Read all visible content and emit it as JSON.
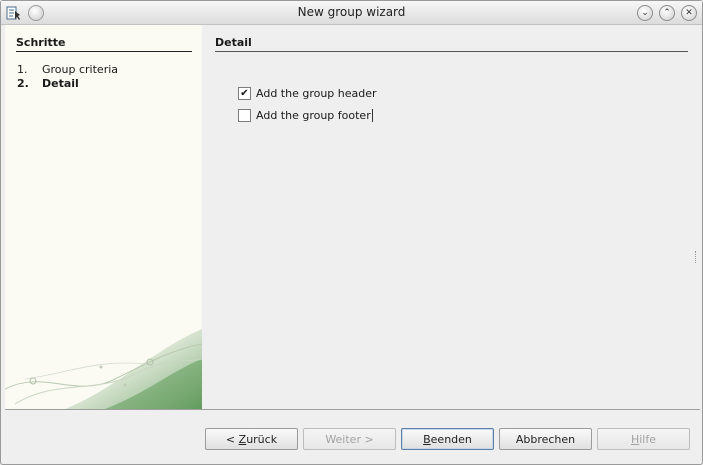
{
  "window": {
    "title": "New group wizard",
    "controls": {
      "minimize_icon": "⌄",
      "maximize_icon": "⌃",
      "close_icon": "✕"
    }
  },
  "steps": {
    "title": "Schritte",
    "items": [
      {
        "num": "1.",
        "label": "Group criteria",
        "active": false
      },
      {
        "num": "2.",
        "label": "Detail",
        "active": true
      }
    ]
  },
  "detail": {
    "title": "Detail",
    "options": [
      {
        "label": "Add the group header",
        "checked": true
      },
      {
        "label": "Add the group footer",
        "checked": false
      }
    ]
  },
  "buttons": {
    "back": {
      "prefix": "< ",
      "mnemonic": "Z",
      "rest": "urück",
      "enabled": true
    },
    "next": {
      "label": "Weiter >",
      "enabled": false
    },
    "finish": {
      "mnemonic": "B",
      "rest": "eenden",
      "enabled": true,
      "default": true
    },
    "cancel": {
      "label": "Abbrechen",
      "enabled": true
    },
    "help": {
      "mnemonic": "H",
      "rest": "ilfe",
      "enabled": false
    }
  },
  "colors": {
    "left_panel_bg": "#fbfbf3",
    "leaf_green": "#6fa46a",
    "default_button_border": "#5e7fa8"
  }
}
